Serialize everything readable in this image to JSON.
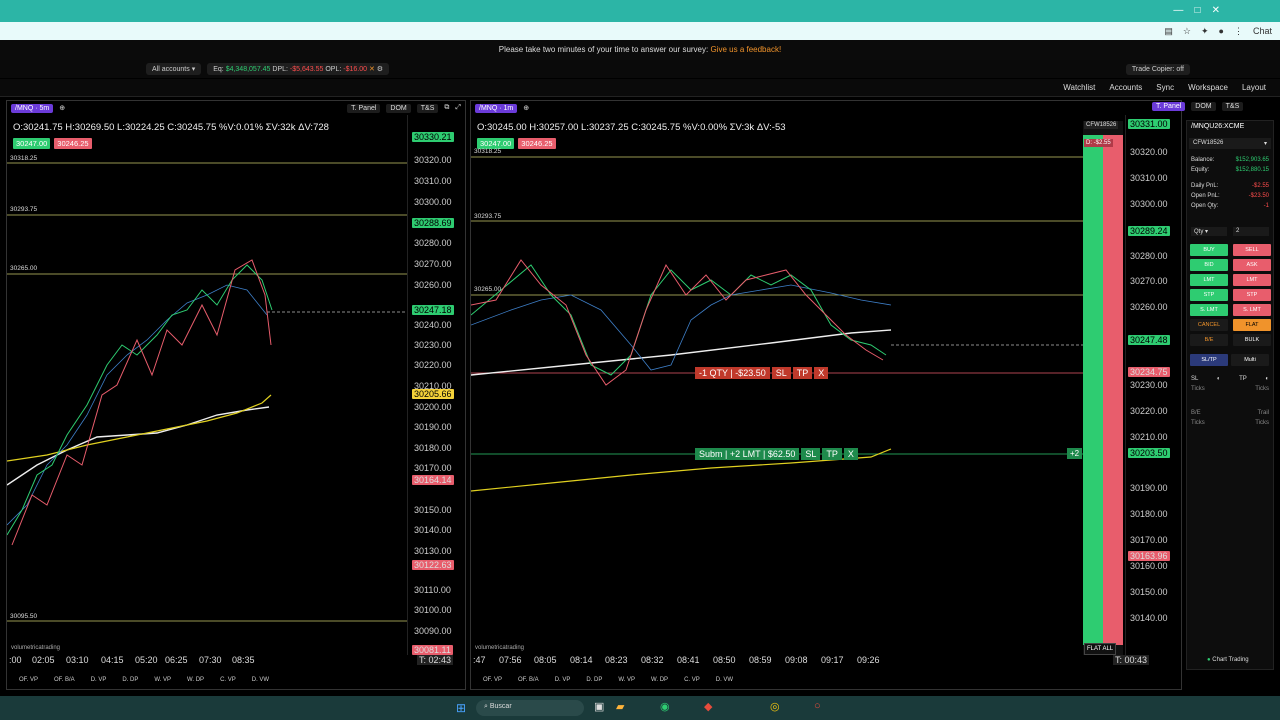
{
  "browser": {
    "tabstrip_icon_label": "Chat"
  },
  "survey": {
    "text": "Please take two minutes of your time to answer our survey:",
    "link": "Give us a feedback!"
  },
  "account_bar": {
    "account_select": "All accounts",
    "eq_label": "Eq:",
    "eq_value": "$4,348,057.45",
    "dpl_label": "DPL:",
    "dpl_value": "-$5,643.55",
    "opl_label": "OPL:",
    "opl_value": "-$16.00",
    "trade_copier": "Trade Copier: off"
  },
  "top_nav": {
    "watchlist": "Watchlist",
    "accounts": "Accounts",
    "sync": "Sync",
    "workspace": "Workspace",
    "layout": "Layout"
  },
  "left_chart": {
    "symbol": "/MNQ",
    "timeframe": "5m",
    "tpanel": "T. Panel",
    "dom": "DOM",
    "ts": "T&S",
    "ohlc": "O:30241.75  H:30269.50  L:30224.25  C:30245.75  %V:0.01%  ΣV:32k  ΔV:728",
    "bid_badge": "30247.00",
    "ask_badge": "30246.25",
    "levels": [
      "30318.25",
      "30293.75",
      "30265.00",
      "30095.50"
    ],
    "axis": [
      "30320.00",
      "30310.00",
      "30300.00",
      "30280.00",
      "30270.00",
      "30260.00",
      "30240.00",
      "30230.00",
      "30220.00",
      "30210.00",
      "30200.00",
      "30190.00",
      "30180.00",
      "30170.00",
      "30150.00",
      "30140.00",
      "30130.00",
      "30110.00",
      "30100.00",
      "30090.00"
    ],
    "tags": {
      "top": "30330.21",
      "green2": "30288.69",
      "current": "30247.18",
      "yellow": "30205.66",
      "red1": "30164.14",
      "red2": "30122.63",
      "red3": "30081.11"
    },
    "times": [
      ":00",
      "02:05",
      "03:10",
      "04:15",
      "05:20",
      "06:25",
      "07:30",
      "08:35"
    ],
    "timer": "T: 02:43",
    "bottom": [
      "OF. VP",
      "OF. B/A",
      "D. VP",
      "D. DP",
      "W. VP",
      "W. DP",
      "C. VP",
      "D. VW"
    ],
    "logo": "volumetricatrading"
  },
  "right_chart": {
    "symbol": "/MNQ",
    "timeframe": "1m",
    "tpanel": "T. Panel",
    "dom": "DOM",
    "ts": "T&S",
    "ohlc": "O:30245.00  H:30257.00  L:30237.25  C:30245.75  %V:0.00%  ΣV:3k  ΔV:-53",
    "bid_badge": "30247.00",
    "ask_badge": "30246.25",
    "levels": [
      "30318.25",
      "30293.75",
      "30265.00"
    ],
    "position": {
      "qty": "-1 QTY",
      "pnl": "-$23.50",
      "sl": "SL",
      "tp": "TP",
      "x": "X"
    },
    "order": {
      "label": "Subm",
      "qty": "+2 LMT",
      "amount": "$62.50",
      "sl": "SL",
      "tp": "TP",
      "x": "X",
      "plus": "+2"
    },
    "account_tag": "CFW18526",
    "pnl_tag": "D: -$2.55",
    "axis": [
      "30320.00",
      "30310.00",
      "30300.00",
      "30280.00",
      "30270.00",
      "30260.00",
      "30230.00",
      "30220.00",
      "30210.00",
      "30190.00",
      "30180.00",
      "30170.00",
      "30160.00",
      "30150.00",
      "30140.00"
    ],
    "tags": {
      "top": "30331.00",
      "green2": "30289.24",
      "current": "30247.48",
      "red": "30234.75",
      "yellow": "30203.50",
      "red2": "30163.96"
    },
    "times": [
      ":47",
      "07:56",
      "08:05",
      "08:14",
      "08:23",
      "08:32",
      "08:41",
      "08:50",
      "08:59",
      "09:08",
      "09:17",
      "09:26"
    ],
    "timer": "T: 00:43",
    "flat_all": "FLAT ALL",
    "bottom": [
      "OF. VP",
      "OF. B/A",
      "D. VP",
      "D. DP",
      "W. VP",
      "W. DP",
      "C. VP",
      "D. VW"
    ],
    "logo": "volumetricatrading"
  },
  "side_panel": {
    "symbol": "/MNQU26:XCME",
    "account": "CFW18526",
    "balance_label": "Balance:",
    "balance": "$152,903.65",
    "equity_label": "Equity:",
    "equity": "$152,880.15",
    "daily_label": "Daily PnL:",
    "daily": "-$2.55",
    "open_label": "Open PnL:",
    "open": "-$23.50",
    "qty_label": "Open Qty:",
    "qty": "-1",
    "qty_select": "Qty",
    "qty_value": "2",
    "buttons": [
      [
        "BUY",
        "SELL"
      ],
      [
        "BID",
        "ASK"
      ],
      [
        "LMT",
        "LMT"
      ],
      [
        "STP",
        "STP"
      ],
      [
        "S. LMT",
        "S. LMT"
      ]
    ],
    "cancel": "CANCEL",
    "flat": "FLAT",
    "be": "B/E",
    "bulk": "BULK",
    "sltp": "SL/TP",
    "multi": "Multi",
    "sl": "SL",
    "tp": "TP",
    "ticks": "Ticks",
    "be_label": "B/E",
    "trail": "Trail",
    "chart_trading": "Chart Trading"
  },
  "taskbar": {
    "search": "Buscar"
  },
  "colors": {
    "green": "#2ecc71",
    "red": "#e85d6c",
    "yellow": "#f5d23a",
    "purple": "#6b3bd9",
    "teal": "#2cb5a6"
  }
}
